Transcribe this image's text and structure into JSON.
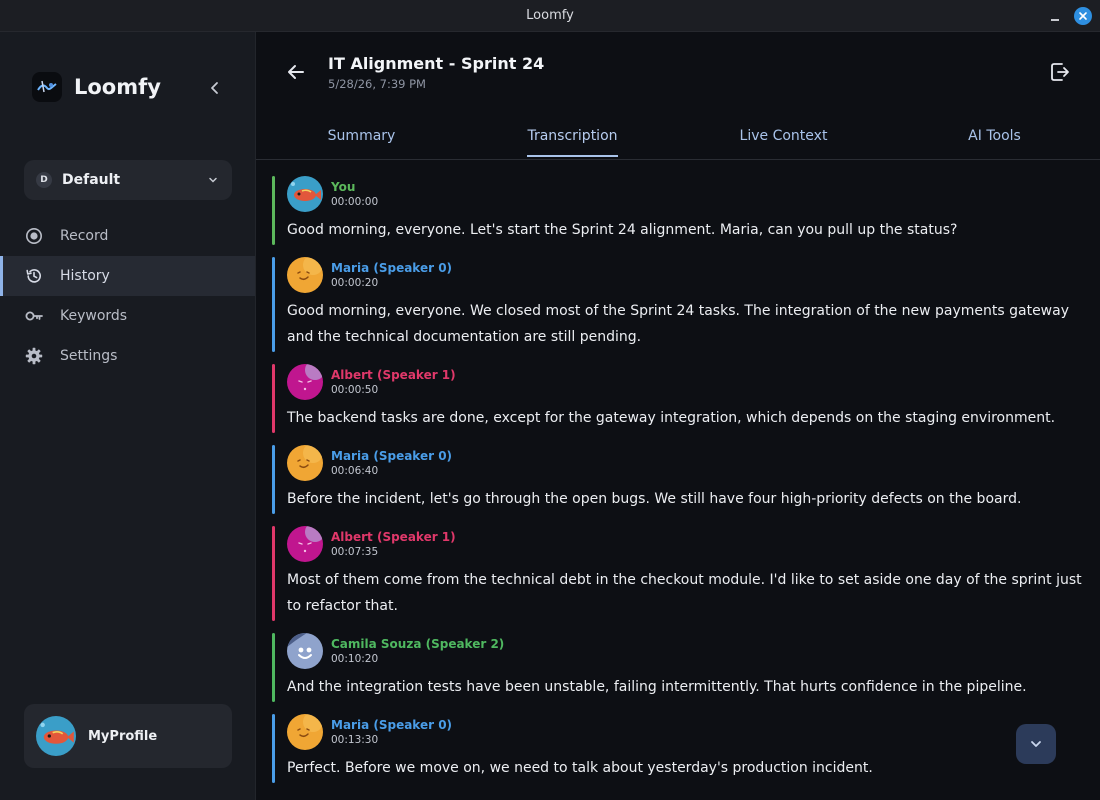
{
  "window": {
    "title": "Loomfy"
  },
  "sidebar": {
    "brand": "Loomfy",
    "workspace": {
      "badge": "D",
      "name": "Default"
    },
    "items": [
      {
        "label": "Record",
        "icon": "record-icon",
        "active": false
      },
      {
        "label": "History",
        "icon": "history-icon",
        "active": true
      },
      {
        "label": "Keywords",
        "icon": "key-icon",
        "active": false
      },
      {
        "label": "Settings",
        "icon": "gear-icon",
        "active": false
      }
    ],
    "profile": {
      "name": "MyProfile"
    }
  },
  "meeting": {
    "title": "IT Alignment - Sprint 24",
    "date": "5/28/26, 7:39 PM"
  },
  "tabs": [
    {
      "label": "Summary",
      "active": false
    },
    {
      "label": "Transcription",
      "active": true
    },
    {
      "label": "Live Context",
      "active": false
    },
    {
      "label": "AI Tools",
      "active": false
    }
  ],
  "colors": {
    "you": "#5cb85c",
    "maria": "#4a9de8",
    "albert": "#e0386a",
    "camila": "#4fb860",
    "accent": "#a9c3ea"
  },
  "transcript": [
    {
      "speaker": "You",
      "time": "00:00:00",
      "color": "#5cb85c",
      "avatar": "fish",
      "text": "Good morning, everyone. Let's start the Sprint 24 alignment. Maria, can you pull up the status?"
    },
    {
      "speaker": "Maria (Speaker 0)",
      "time": "00:00:20",
      "color": "#4a9de8",
      "avatar": "orange",
      "text": "Good morning, everyone. We closed most of the Sprint 24 tasks. The integration of the new payments gateway and the technical documentation are still pending."
    },
    {
      "speaker": "Albert (Speaker 1)",
      "time": "00:00:50",
      "color": "#e0386a",
      "avatar": "pink",
      "text": "The backend tasks are done, except for the gateway integration, which depends on the staging environment."
    },
    {
      "speaker": "Maria (Speaker 0)",
      "time": "00:06:40",
      "color": "#4a9de8",
      "avatar": "orange",
      "text": "Before the incident, let's go through the open bugs. We still have four high-priority defects on the board."
    },
    {
      "speaker": "Albert (Speaker 1)",
      "time": "00:07:35",
      "color": "#e0386a",
      "avatar": "pink",
      "text": "Most of them come from the technical debt in the checkout module. I'd like to set aside one day of the sprint just to refactor that."
    },
    {
      "speaker": "Camila Souza (Speaker 2)",
      "time": "00:10:20",
      "color": "#4fb860",
      "avatar": "blue",
      "text": "And the integration tests have been unstable, failing intermittently. That hurts confidence in the pipeline."
    },
    {
      "speaker": "Maria (Speaker 0)",
      "time": "00:13:30",
      "color": "#4a9de8",
      "avatar": "orange",
      "text": "Perfect. Before we move on, we need to talk about yesterday's production incident."
    }
  ]
}
